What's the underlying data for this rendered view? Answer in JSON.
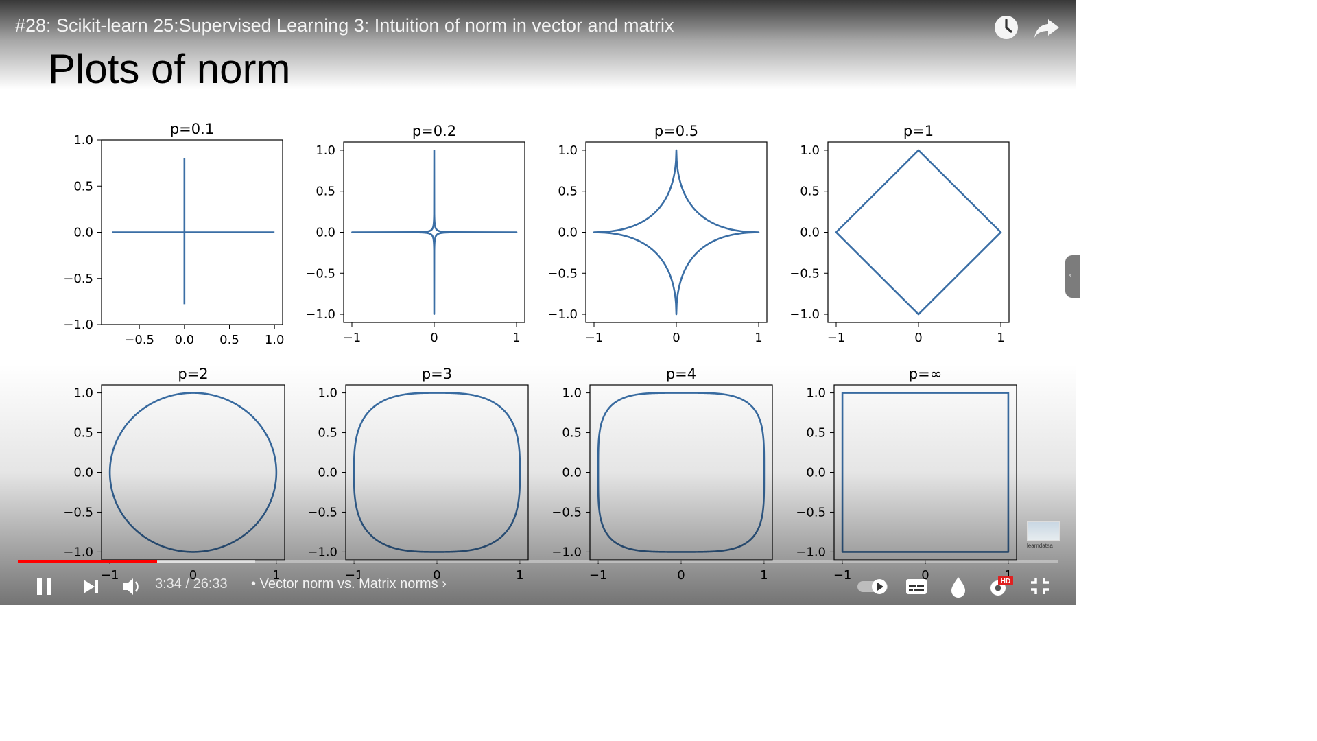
{
  "video": {
    "title": "#28: Scikit-learn 25:Supervised Learning 3: Intuition of norm in vector and matrix",
    "current_time": "3:34",
    "time_separator": "/",
    "duration": "26:33",
    "chapter_separator": "•",
    "chapter_title": "Vector norm vs. Matrix norms",
    "chapter_arrow": "›",
    "progress_played": 0.134,
    "progress_buffered": 0.228,
    "channel_watermark": "learndataa",
    "hd_badge": "HD"
  },
  "slide": {
    "title": "Plots of norm"
  },
  "icons": {
    "watch_later": "clock-icon",
    "share": "share-arrow-icon",
    "pause": "pause-icon",
    "next": "next-icon",
    "volume": "volume-icon",
    "autoplay": "autoplay-toggle-icon",
    "subtitles": "subtitles-icon",
    "ambient": "ambient-mode-icon",
    "settings": "settings-gear-icon",
    "exit_fullscreen": "exit-fullscreen-icon",
    "side_panel": "chevron-left-icon"
  },
  "colors": {
    "series": "#3a6ea5",
    "progress": "#ff0000"
  },
  "chart_data": [
    {
      "type": "line",
      "title": "p=0.1",
      "p": 0.1,
      "xlim": [
        -0.92,
        1.09
      ],
      "ylim": [
        -1.0,
        1.0
      ],
      "xticks": [
        -0.5,
        0.0,
        0.5,
        1.0
      ],
      "xticklabels": [
        "−0.5",
        "0.0",
        "0.5",
        "1.0"
      ],
      "yticks": [
        -1.0,
        -0.5,
        0.0,
        0.5,
        1.0
      ],
      "yticklabels": [
        "−1.0",
        "−0.5",
        "0.0",
        "0.5",
        "1.0"
      ],
      "extent": {
        "x": [
          -0.8,
          1.0
        ],
        "y": [
          -0.78,
          0.8
        ]
      }
    },
    {
      "type": "line",
      "title": "p=0.2",
      "p": 0.2,
      "xlim": [
        -1.1,
        1.1
      ],
      "ylim": [
        -1.1,
        1.1
      ],
      "xticks": [
        -1,
        0,
        1
      ],
      "xticklabels": [
        "−1",
        "0",
        "1"
      ],
      "yticks": [
        -1.0,
        -0.5,
        0.0,
        0.5,
        1.0
      ],
      "yticklabels": [
        "−1.0",
        "−0.5",
        "0.0",
        "0.5",
        "1.0"
      ]
    },
    {
      "type": "line",
      "title": "p=0.5",
      "p": 0.5,
      "xlim": [
        -1.1,
        1.1
      ],
      "ylim": [
        -1.1,
        1.1
      ],
      "xticks": [
        -1,
        0,
        1
      ],
      "xticklabels": [
        "−1",
        "0",
        "1"
      ],
      "yticks": [
        -1.0,
        -0.5,
        0.0,
        0.5,
        1.0
      ],
      "yticklabels": [
        "−1.0",
        "−0.5",
        "0.0",
        "0.5",
        "1.0"
      ]
    },
    {
      "type": "line",
      "title": "p=1",
      "p": 1,
      "xlim": [
        -1.1,
        1.1
      ],
      "ylim": [
        -1.1,
        1.1
      ],
      "xticks": [
        -1,
        0,
        1
      ],
      "xticklabels": [
        "−1",
        "0",
        "1"
      ],
      "yticks": [
        -1.0,
        -0.5,
        0.0,
        0.5,
        1.0
      ],
      "yticklabels": [
        "−1.0",
        "−0.5",
        "0.0",
        "0.5",
        "1.0"
      ]
    },
    {
      "type": "line",
      "title": "p=2",
      "p": 2,
      "xlim": [
        -1.1,
        1.1
      ],
      "ylim": [
        -1.1,
        1.1
      ],
      "xticks": [
        -1,
        0,
        1
      ],
      "xticklabels": [
        "−1",
        "0",
        "1"
      ],
      "yticks": [
        -1.0,
        -0.5,
        0.0,
        0.5,
        1.0
      ],
      "yticklabels": [
        "−1.0",
        "−0.5",
        "0.0",
        "0.5",
        "1.0"
      ]
    },
    {
      "type": "line",
      "title": "p=3",
      "p": 3,
      "xlim": [
        -1.1,
        1.1
      ],
      "ylim": [
        -1.1,
        1.1
      ],
      "xticks": [
        -1,
        0,
        1
      ],
      "xticklabels": [
        "−1",
        "0",
        "1"
      ],
      "yticks": [
        -1.0,
        -0.5,
        0.0,
        0.5,
        1.0
      ],
      "yticklabels": [
        "−1.0",
        "−0.5",
        "0.0",
        "0.5",
        "1.0"
      ]
    },
    {
      "type": "line",
      "title": "p=4",
      "p": 4,
      "xlim": [
        -1.1,
        1.1
      ],
      "ylim": [
        -1.1,
        1.1
      ],
      "xticks": [
        -1,
        0,
        1
      ],
      "xticklabels": [
        "−1",
        "0",
        "1"
      ],
      "yticks": [
        -1.0,
        -0.5,
        0.0,
        0.5,
        1.0
      ],
      "yticklabels": [
        "−1.0",
        "−0.5",
        "0.0",
        "0.5",
        "1.0"
      ]
    },
    {
      "type": "line",
      "title": "p=∞",
      "p": "inf",
      "xlim": [
        -1.1,
        1.1
      ],
      "ylim": [
        -1.1,
        1.1
      ],
      "xticks": [
        -1,
        0,
        1
      ],
      "xticklabels": [
        "−1",
        "0",
        "1"
      ],
      "yticks": [
        -1.0,
        -0.5,
        0.0,
        0.5,
        1.0
      ],
      "yticklabels": [
        "−1.0",
        "−0.5",
        "0.0",
        "0.5",
        "1.0"
      ]
    }
  ]
}
